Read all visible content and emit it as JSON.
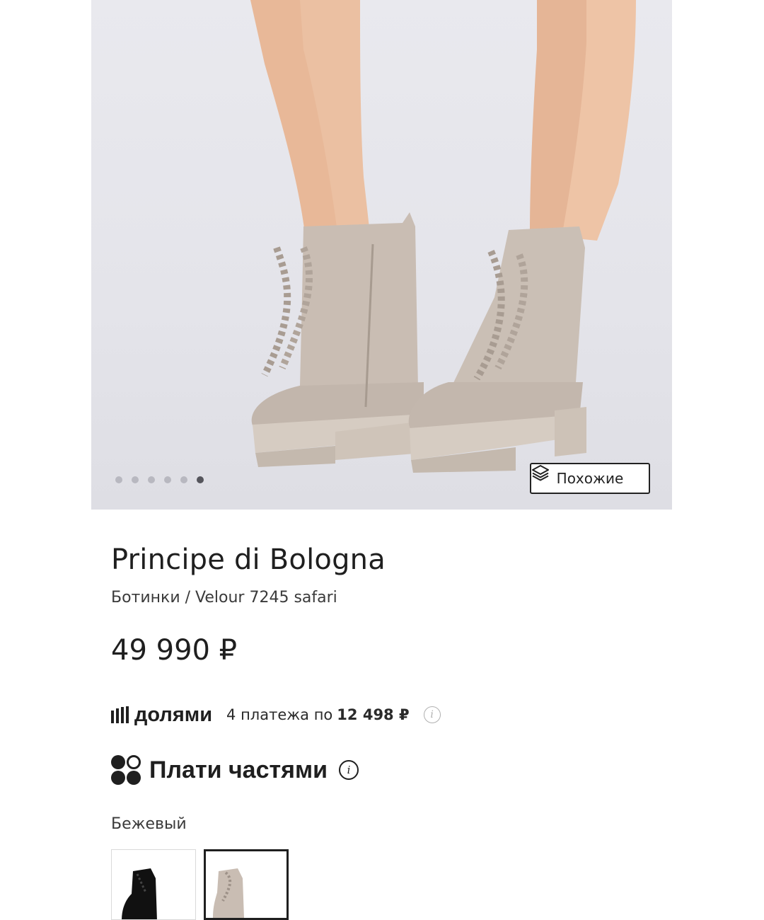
{
  "gallery": {
    "image_alt": "beige-suede-lace-up-boots",
    "dots_total": 6,
    "active_dot": 5,
    "similar_button": {
      "label": "Похожие",
      "icon": "layers-icon"
    }
  },
  "product": {
    "brand": "Principe di Bologna",
    "subtitle": "Ботинки / Velour 7245 safari",
    "price": "49 990 ₽"
  },
  "dolyami": {
    "brand": "долями",
    "text": "4 платежа по",
    "amount": "12 498 ₽",
    "info_icon": "info-icon"
  },
  "chasti": {
    "label": "Плати частями",
    "info_icon": "info-icon"
  },
  "color": {
    "label": "Бежевый",
    "swatches": [
      {
        "name": "black-boot",
        "color": "#111111",
        "selected": false
      },
      {
        "name": "beige-boot",
        "color": "#c9bdb3",
        "selected": true
      }
    ]
  },
  "colors": {
    "accent": "#1f1f1f",
    "photo_bg": "#e6e6eb",
    "boot_beige": "#c9bdb3"
  }
}
